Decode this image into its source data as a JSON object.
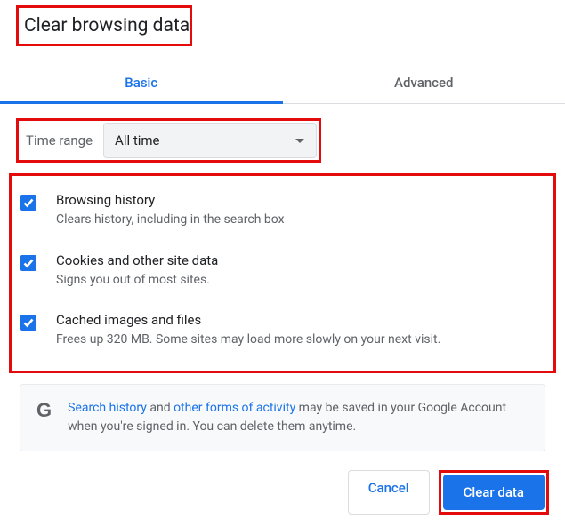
{
  "title": "Clear browsing data",
  "tabs": {
    "basic": "Basic",
    "advanced": "Advanced"
  },
  "time": {
    "label": "Time range",
    "value": "All time"
  },
  "options": [
    {
      "title": "Browsing history",
      "desc": "Clears history, including in the search box"
    },
    {
      "title": "Cookies and other site data",
      "desc": "Signs you out of most sites."
    },
    {
      "title": "Cached images and files",
      "desc": "Frees up 320 MB. Some sites may load more slowly on your next visit."
    }
  ],
  "info": {
    "link1": "Search history",
    "text1": " and ",
    "link2": "other forms of activity",
    "text2": " may be saved in your Google Account when you're signed in. You can delete them anytime."
  },
  "buttons": {
    "cancel": "Cancel",
    "clear": "Clear data"
  }
}
